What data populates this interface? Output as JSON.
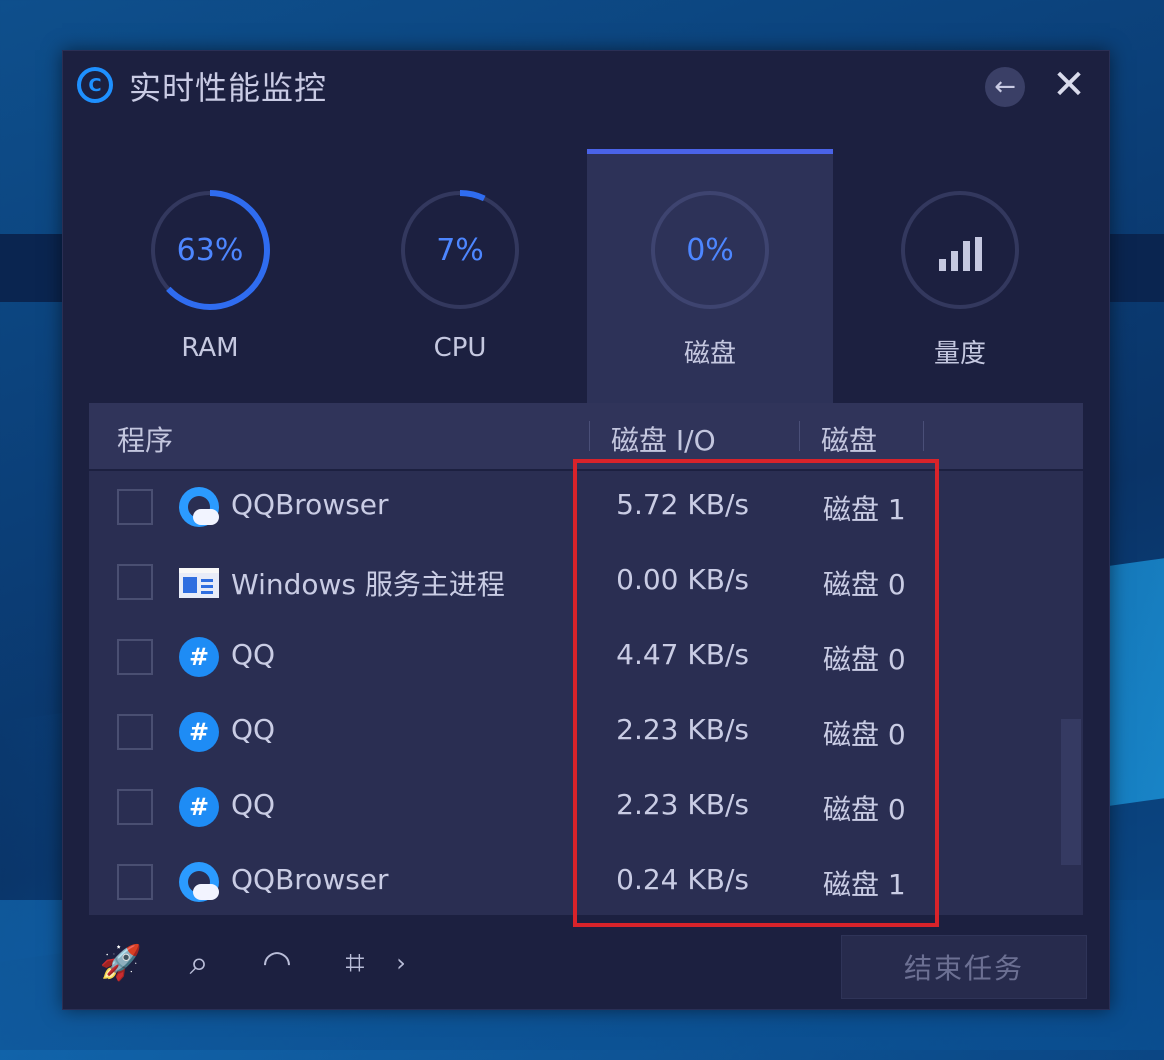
{
  "window": {
    "title": "实时性能监控",
    "logo_icon": "copyright-circle-icon",
    "back_icon": "arrow-left-icon",
    "close_icon": "close-icon"
  },
  "tabs": [
    {
      "label": "RAM",
      "value": "63%",
      "percent": 63
    },
    {
      "label": "CPU",
      "value": "7%",
      "percent": 7
    },
    {
      "label": "磁盘",
      "value": "0%",
      "percent": 0,
      "active": true
    },
    {
      "label": "量度",
      "icon": "bar-chart-icon"
    }
  ],
  "table": {
    "headers": {
      "program": "程序",
      "disk_io": "磁盘 I/O",
      "disk": "磁盘"
    },
    "rows": [
      {
        "name": "QQBrowser",
        "icon": "qqbrowser-icon",
        "io": "5.72 KB/s",
        "disk": "磁盘 1"
      },
      {
        "name": "Windows 服务主进程",
        "icon": "windows-service-icon",
        "io": "0.00 KB/s",
        "disk": "磁盘 0"
      },
      {
        "name": "QQ",
        "icon": "qq-icon",
        "io": "4.47 KB/s",
        "disk": "磁盘 0"
      },
      {
        "name": "QQ",
        "icon": "qq-icon",
        "io": "2.23 KB/s",
        "disk": "磁盘 0"
      },
      {
        "name": "QQ",
        "icon": "qq-icon",
        "io": "2.23 KB/s",
        "disk": "磁盘 0"
      },
      {
        "name": "QQBrowser",
        "icon": "qqbrowser-icon",
        "io": "0.24 KB/s",
        "disk": "磁盘 1"
      }
    ]
  },
  "footer": {
    "icons": [
      "rocket-icon",
      "search-icon",
      "speedometer-icon",
      "crop-icon",
      "chevron-right-icon"
    ],
    "end_task": "结束任务"
  },
  "colors": {
    "accent": "#4d86ff",
    "highlight": "#d8232a",
    "window_bg": "#1c2040"
  }
}
